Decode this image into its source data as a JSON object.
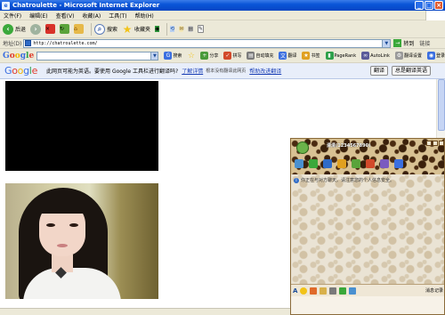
{
  "window": {
    "title": "Chatroulette - Microsoft Internet Explorer"
  },
  "menu": {
    "items": [
      "文件(F)",
      "编辑(E)",
      "查看(V)",
      "收藏(A)",
      "工具(T)",
      "帮助(H)"
    ]
  },
  "toolbar": {
    "back_label": "后退",
    "search_label": "搜索",
    "favorites_label": "收藏夹"
  },
  "address": {
    "label": "地址(D)",
    "url": "http://chatroulette.com/",
    "go_label": "转到",
    "links_label": "链接"
  },
  "google_toolbar": {
    "logo": "Google",
    "items": [
      {
        "label": "搜索",
        "icon": "search-icon"
      },
      {
        "label": "",
        "icon": "star-icon"
      },
      {
        "label": "分享",
        "icon": "share-icon"
      },
      {
        "label": "拼写",
        "icon": "spellcheck-icon"
      },
      {
        "label": "自动填充",
        "icon": "autofill-icon"
      },
      {
        "label": "翻译",
        "icon": "translate-icon"
      },
      {
        "label": "书签",
        "icon": "bookmark-icon"
      },
      {
        "label": "PageRank",
        "icon": "pagerank-icon"
      },
      {
        "label": "AutoLink",
        "icon": "autolink-icon"
      },
      {
        "label": "翻译设置",
        "icon": "settings-icon"
      },
      {
        "label": "登录",
        "icon": "signin-icon"
      }
    ]
  },
  "translate_bar": {
    "logo": "Google",
    "message": "此网页可能为英语。要使用 Google 工具栏进行翻译吗?",
    "link_label": "了解详情",
    "note": "根本没有翻译此网页",
    "help_link": "帮助改进翻译",
    "translate_button": "翻译",
    "always_button": "总是翻译英语"
  },
  "chat_window": {
    "nickname": "清清(1234567890)",
    "system_message": "你正在与对方聊天。请注意您的个人信息安全。",
    "font_label": "A",
    "msg_log_label": "消息记录"
  },
  "colors": {
    "titlebar": "#0a55d8",
    "chrome": "#ece9d8",
    "translate_bar": "#e8eefa"
  }
}
